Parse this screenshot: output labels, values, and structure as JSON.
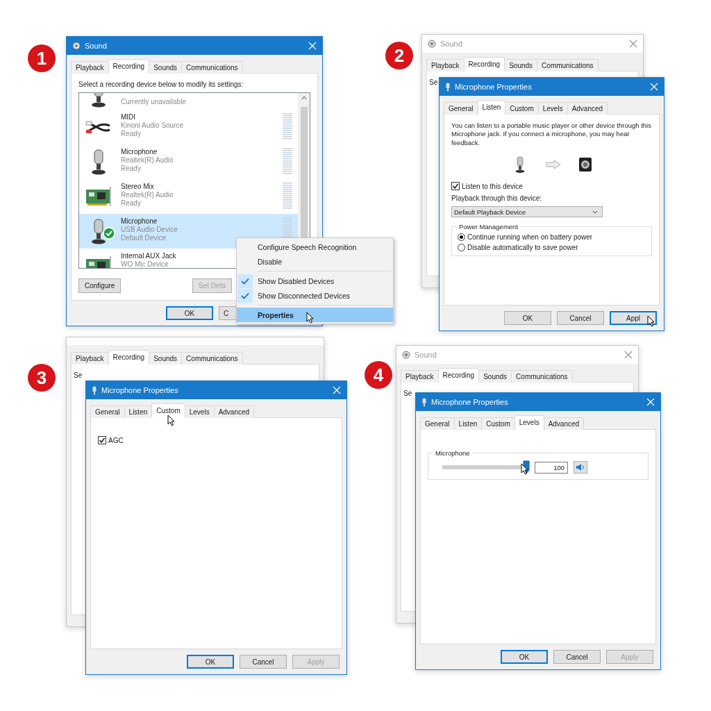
{
  "steps": [
    {
      "number": "1",
      "sound_window": {
        "title": "Sound",
        "active": true,
        "tabs": [
          {
            "label": "Playback",
            "selected": false
          },
          {
            "label": "Recording",
            "selected": true
          },
          {
            "label": "Sounds",
            "selected": false
          },
          {
            "label": "Communications",
            "selected": false
          }
        ],
        "instruction": "Select a recording device below to modify its settings:",
        "devices": [
          {
            "kind": "mic",
            "lines": [
              "Currently unavailable"
            ],
            "selected": false,
            "default": false
          },
          {
            "kind": "cable",
            "name": "MIDI",
            "lines": [
              "Kinoni Audio Source",
              "Ready"
            ],
            "selected": false,
            "default": false
          },
          {
            "kind": "mic",
            "name": "Microphone",
            "lines": [
              "Realtek(R) Audio",
              "Ready"
            ],
            "selected": false,
            "default": false
          },
          {
            "kind": "card",
            "name": "Stereo Mix",
            "lines": [
              "Realtek(R) Audio",
              "Ready"
            ],
            "selected": false,
            "default": false
          },
          {
            "kind": "mic",
            "name": "Microphone",
            "lines": [
              "USB Audio Device",
              "Default Device"
            ],
            "selected": true,
            "default": true
          },
          {
            "kind": "card",
            "name": "Internal AUX Jack",
            "lines": [
              "WO Mic Device"
            ],
            "selected": false,
            "default": false
          }
        ],
        "buttons": [
          {
            "label": "Configure",
            "disabled": false
          },
          {
            "label": "Set Defa",
            "disabled": true
          }
        ],
        "footer": [
          {
            "label": "OK",
            "default": true,
            "disabled": false
          },
          {
            "label": "C",
            "default": false,
            "disabled": false
          }
        ]
      },
      "context_menu": [
        {
          "kind": "item",
          "label": "Configure Speech Recognition",
          "checked": false,
          "selected": false
        },
        {
          "kind": "item",
          "label": "Disable",
          "checked": false,
          "selected": false
        },
        {
          "kind": "separator"
        },
        {
          "kind": "item",
          "label": "Show Disabled Devices",
          "checked": true,
          "selected": false
        },
        {
          "kind": "item",
          "label": "Show Disconnected Devices",
          "checked": true,
          "selected": false
        },
        {
          "kind": "separator"
        },
        {
          "kind": "item",
          "label": "Properties",
          "checked": false,
          "selected": true,
          "pointer": true
        }
      ]
    },
    {
      "number": "2",
      "sound_window": {
        "title": "Sound",
        "active": false,
        "tabs": [
          {
            "label": "Playback",
            "selected": false
          },
          {
            "label": "Recording",
            "selected": true
          },
          {
            "label": "Sounds",
            "selected": false
          },
          {
            "label": "Communications",
            "selected": false
          }
        ],
        "instruction": "Se"
      },
      "properties": {
        "title": "Microphone Properties",
        "active": true,
        "tabs": [
          {
            "label": "General",
            "selected": false
          },
          {
            "label": "Listen",
            "selected": true
          },
          {
            "label": "Custom",
            "selected": false
          },
          {
            "label": "Levels",
            "selected": false
          },
          {
            "label": "Advanced",
            "selected": false
          }
        ],
        "content": {
          "kind": "listen",
          "description": "You can listen to a portable music player or other device through this Microphone jack.  If you connect a microphone, you may hear feedback.",
          "checkbox": {
            "label": "Listen to this device",
            "checked": true
          },
          "playback_label": "Playback through this device:",
          "playback_device": "Default Playback Device",
          "group": "Power Management",
          "radios": [
            {
              "label": "Continue running when on battery power",
              "selected": true
            },
            {
              "label": "Disable automatically to save power",
              "selected": false
            }
          ]
        },
        "footer": [
          {
            "label": "OK",
            "default": false,
            "disabled": false
          },
          {
            "label": "Cancel",
            "default": false,
            "disabled": false
          },
          {
            "label": "Appl",
            "default": true,
            "disabled": false,
            "pointer": true
          }
        ]
      }
    },
    {
      "number": "3",
      "sound_window": {
        "active": false,
        "tabs": [
          {
            "label": "Playback",
            "selected": false
          },
          {
            "label": "Recording",
            "selected": true
          },
          {
            "label": "Sounds",
            "selected": false
          },
          {
            "label": "Communications",
            "selected": false
          }
        ],
        "instruction": "Se"
      },
      "properties": {
        "title": "Microphone Properties",
        "active": true,
        "tabs": [
          {
            "label": "General",
            "selected": false
          },
          {
            "label": "Listen",
            "selected": false
          },
          {
            "label": "Custom",
            "selected": true,
            "pointer": true
          },
          {
            "label": "Levels",
            "selected": false
          },
          {
            "label": "Advanced",
            "selected": false
          }
        ],
        "content": {
          "kind": "custom",
          "checkbox": {
            "label": "AGC",
            "checked": true
          }
        },
        "footer": [
          {
            "label": "OK",
            "default": true,
            "disabled": false
          },
          {
            "label": "Cancel",
            "default": false,
            "disabled": false
          },
          {
            "label": "Apply",
            "default": false,
            "disabled": true
          }
        ]
      }
    },
    {
      "number": "4",
      "sound_window": {
        "title": "Sound",
        "active": false,
        "tabs": [
          {
            "label": "Playback",
            "selected": false
          },
          {
            "label": "Recording",
            "selected": true
          },
          {
            "label": "Sounds",
            "selected": false
          },
          {
            "label": "Communications",
            "selected": false
          }
        ],
        "instruction": "Se"
      },
      "properties": {
        "title": "Microphone Properties",
        "active": true,
        "tabs": [
          {
            "label": "General",
            "selected": false
          },
          {
            "label": "Listen",
            "selected": false
          },
          {
            "label": "Custom",
            "selected": false
          },
          {
            "label": "Levels",
            "selected": true
          },
          {
            "label": "Advanced",
            "selected": false
          }
        ],
        "content": {
          "kind": "levels",
          "group": "Microphone",
          "level": 1,
          "value": "100",
          "muted": false,
          "pointer": true
        },
        "footer": [
          {
            "label": "OK",
            "default": true,
            "disabled": false
          },
          {
            "label": "Cancel",
            "default": false,
            "disabled": false
          },
          {
            "label": "Apply",
            "default": false,
            "disabled": true
          }
        ]
      }
    }
  ]
}
